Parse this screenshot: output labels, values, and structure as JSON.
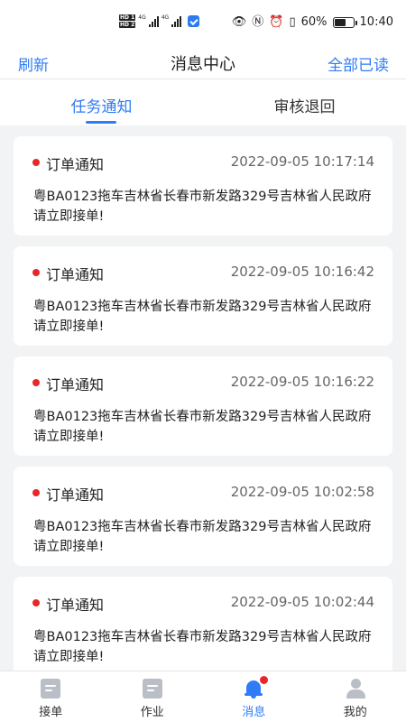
{
  "status_bar": {
    "hd1": "HD 1",
    "hd2": "HD 2",
    "net1": "4G",
    "net2": "4G",
    "battery_percent": "60%",
    "time": "10:40"
  },
  "header": {
    "left_action": "刷新",
    "title": "消息中心",
    "right_action": "全部已读"
  },
  "tabs": [
    {
      "label": "任务通知",
      "active": true
    },
    {
      "label": "审核退回",
      "active": false
    }
  ],
  "messages": [
    {
      "title": "订单通知",
      "time": "2022-09-05 10:17:14",
      "body": "粤BA0123拖车吉林省长春市新发路329号吉林省人民政府 请立即接单!"
    },
    {
      "title": "订单通知",
      "time": "2022-09-05 10:16:42",
      "body": "粤BA0123拖车吉林省长春市新发路329号吉林省人民政府 请立即接单!"
    },
    {
      "title": "订单通知",
      "time": "2022-09-05 10:16:22",
      "body": "粤BA0123拖车吉林省长春市新发路329号吉林省人民政府 请立即接单!"
    },
    {
      "title": "订单通知",
      "time": "2022-09-05 10:02:58",
      "body": "粤BA0123拖车吉林省长春市新发路329号吉林省人民政府 请立即接单!"
    },
    {
      "title": "订单通知",
      "time": "2022-09-05 10:02:44",
      "body": "粤BA0123拖车吉林省长春市新发路329号吉林省人民政府 请立即接单!"
    }
  ],
  "bottom_nav": [
    {
      "label": "接单",
      "icon": "order-doc-icon",
      "active": false
    },
    {
      "label": "作业",
      "icon": "task-doc-icon",
      "active": false
    },
    {
      "label": "消息",
      "icon": "bell-icon",
      "active": true
    },
    {
      "label": "我的",
      "icon": "user-icon",
      "active": false
    }
  ],
  "colors": {
    "accent": "#2f7cf6",
    "unread_dot": "#e8262a",
    "list_background": "#f2f3f5",
    "inactive_icon": "#b9bec7"
  }
}
